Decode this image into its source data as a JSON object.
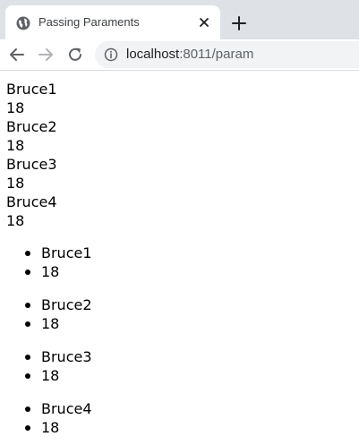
{
  "browser": {
    "tab": {
      "title": "Passing Paraments",
      "favicon": "globe-icon",
      "close_icon": "close-icon"
    },
    "new_tab_icon": "plus-icon",
    "toolbar": {
      "back_icon": "arrow-left-icon",
      "forward_icon": "arrow-right-icon",
      "reload_icon": "reload-icon",
      "info_icon": "info-icon",
      "url_host": "localhost",
      "url_rest": ":8011/param"
    }
  },
  "page": {
    "plain_lines": [
      "Bruce1",
      "18",
      "Bruce2",
      "18",
      "Bruce3",
      "18",
      "Bruce4",
      "18"
    ],
    "lists": [
      [
        "Bruce1",
        "18"
      ],
      [
        "Bruce2",
        "18"
      ],
      [
        "Bruce3",
        "18"
      ],
      [
        "Bruce4",
        "18"
      ]
    ]
  },
  "colors": {
    "tabstrip": "#dee1e6",
    "omnibox": "#f1f3f4",
    "icon": "#5f6368",
    "disabled_icon": "#b0b3b8"
  }
}
